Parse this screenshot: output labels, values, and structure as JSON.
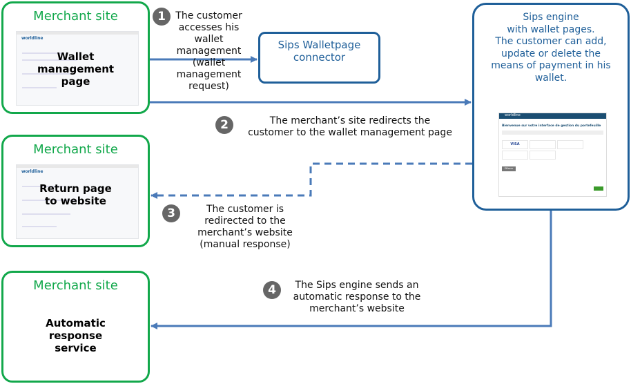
{
  "merchant_boxes": [
    {
      "title": "Merchant site",
      "label_lines": [
        "Wallet",
        "management",
        "page"
      ]
    },
    {
      "title": "Merchant site",
      "label_lines": [
        "Return page",
        "to website"
      ]
    },
    {
      "title": "Merchant site",
      "label_lines": [
        "Automatic",
        "response",
        "service"
      ]
    }
  ],
  "connector": {
    "lines": [
      "Sips Walletpage",
      "connector"
    ]
  },
  "engine": {
    "lines": [
      "Sips engine",
      "with wallet pages.",
      "The customer can add,",
      "update or delete the",
      "means of payment in his",
      "wallet."
    ],
    "screenshot": {
      "brand": "worldline",
      "heading": "Bienvenue sur votre interface de gestion du portefeuille",
      "card_brands": [
        "VISA"
      ],
      "delete_button": "Effacer"
    }
  },
  "mini_brand": "worldline",
  "steps": [
    {
      "number": "1",
      "lines": [
        "The customer",
        "accesses his",
        "wallet",
        "management",
        "(wallet",
        "management",
        "request)"
      ]
    },
    {
      "number": "2",
      "lines": [
        "The merchant’s site redirects the",
        "customer to the wallet management page"
      ]
    },
    {
      "number": "3",
      "lines": [
        "The customer is",
        "redirected to the",
        "merchant’s website",
        "(manual response)"
      ]
    },
    {
      "number": "4",
      "lines": [
        "The Sips engine sends an",
        "automatic response to the",
        "merchant’s website"
      ]
    }
  ],
  "colors": {
    "merchant_border": "#12a84b",
    "sips_blue": "#1f5f99",
    "arrow": "#4a7ab8",
    "step_circle": "#666666"
  }
}
